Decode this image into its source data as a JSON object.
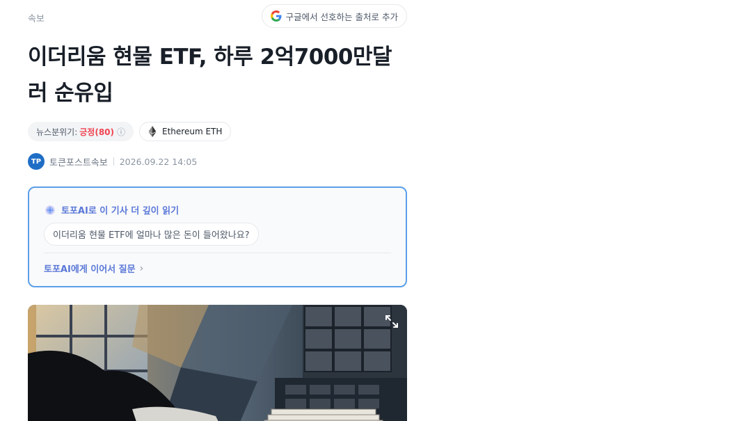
{
  "header": {
    "category": "속보",
    "google_button_label": "구글에서 선호하는 출처로 추가",
    "google_icon": "google-g-icon"
  },
  "article": {
    "title": "이더리움 현물 ETF, 하루 2억7000만달러 순유입",
    "sentiment_label": "뉴스분위기:",
    "sentiment_value": "긍정(80)",
    "sentiment_info_icon": "ⓘ",
    "coin_label": "Ethereum ETH",
    "coin_icon": "ethereum-icon",
    "author": "토큰포스트속보",
    "author_avatar_text": "TP",
    "date": "2026.09.22 14:05"
  },
  "ai_box": {
    "heading": "토포AI로 이 기사 더 깊이 읽기",
    "question": "이더리움 현물 ETF에 얼마나 많은 돈이 들어왔나요?",
    "more_label": "토포AI에게 이어서 질문",
    "more_chevron": "›"
  },
  "image": {
    "expand_icon": "expand-icon"
  },
  "colors": {
    "accent": "#5a78d8",
    "border_accent": "#5b9ee8",
    "positive": "#f04452"
  }
}
